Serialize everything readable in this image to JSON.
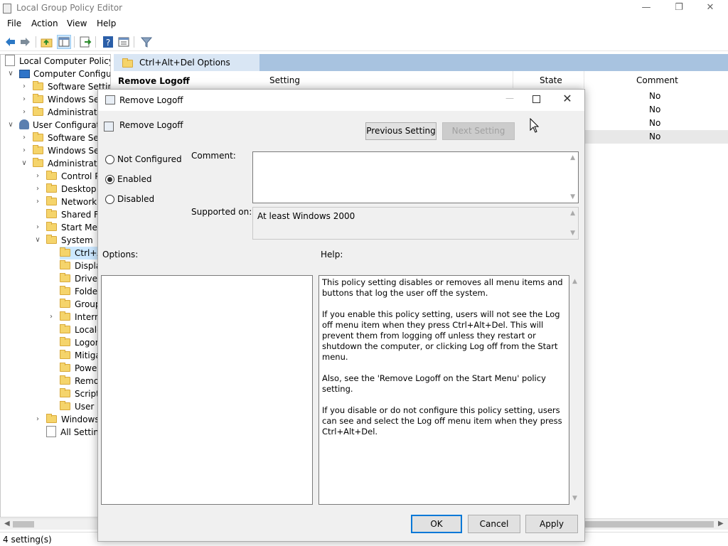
{
  "window": {
    "title": "Local Group Policy Editor"
  },
  "menu": [
    "File",
    "Action",
    "View",
    "Help"
  ],
  "tree": {
    "root": "Local Computer Policy",
    "items": [
      {
        "label": "Computer Configura",
        "indent": 1,
        "icon": "pc-icon",
        "expander": "expanded"
      },
      {
        "label": "Software Settings",
        "indent": 2,
        "icon": "folder-icon",
        "expander": "collapsed"
      },
      {
        "label": "Windows Setti",
        "indent": 2,
        "icon": "folder-icon",
        "expander": "collapsed"
      },
      {
        "label": "Administrative",
        "indent": 2,
        "icon": "folder-icon",
        "expander": "collapsed"
      },
      {
        "label": "User Configuratio",
        "indent": 1,
        "icon": "user-icon",
        "expander": "expanded"
      },
      {
        "label": "Software Setti",
        "indent": 2,
        "icon": "folder-icon",
        "expander": "collapsed"
      },
      {
        "label": "Windows Setti",
        "indent": 2,
        "icon": "folder-icon",
        "expander": "collapsed"
      },
      {
        "label": "Administrative",
        "indent": 2,
        "icon": "folder-icon",
        "expander": "expanded"
      },
      {
        "label": "Control Pa",
        "indent": 3,
        "icon": "folder-icon",
        "expander": "collapsed"
      },
      {
        "label": "Desktop",
        "indent": 3,
        "icon": "folder-icon",
        "expander": "collapsed"
      },
      {
        "label": "Network",
        "indent": 3,
        "icon": "folder-icon",
        "expander": "collapsed"
      },
      {
        "label": "Shared Fol",
        "indent": 3,
        "icon": "folder-icon",
        "expander": "none"
      },
      {
        "label": "Start Menu",
        "indent": 3,
        "icon": "folder-icon",
        "expander": "collapsed"
      },
      {
        "label": "System",
        "indent": 3,
        "icon": "folder-icon",
        "expander": "expanded"
      },
      {
        "label": "Ctrl+A",
        "indent": 4,
        "icon": "folder-icon",
        "expander": "none",
        "selected": true
      },
      {
        "label": "Display",
        "indent": 4,
        "icon": "folder-icon",
        "expander": "none"
      },
      {
        "label": "Driver I",
        "indent": 4,
        "icon": "folder-icon",
        "expander": "none"
      },
      {
        "label": "Folder",
        "indent": 4,
        "icon": "folder-icon",
        "expander": "none"
      },
      {
        "label": "Group",
        "indent": 4,
        "icon": "folder-icon",
        "expander": "none"
      },
      {
        "label": "Interne",
        "indent": 4,
        "icon": "folder-icon",
        "expander": "collapsed"
      },
      {
        "label": "Locale",
        "indent": 4,
        "icon": "folder-icon",
        "expander": "none"
      },
      {
        "label": "Logon",
        "indent": 4,
        "icon": "folder-icon",
        "expander": "none"
      },
      {
        "label": "Mitigat",
        "indent": 4,
        "icon": "folder-icon",
        "expander": "none"
      },
      {
        "label": "Power",
        "indent": 4,
        "icon": "folder-icon",
        "expander": "none"
      },
      {
        "label": "Remov",
        "indent": 4,
        "icon": "folder-icon",
        "expander": "none"
      },
      {
        "label": "Scripts",
        "indent": 4,
        "icon": "folder-icon",
        "expander": "none"
      },
      {
        "label": "User Pr",
        "indent": 4,
        "icon": "folder-icon",
        "expander": "none"
      },
      {
        "label": "Windows C",
        "indent": 3,
        "icon": "folder-icon",
        "expander": "collapsed"
      },
      {
        "label": "All Setting",
        "indent": 3,
        "icon": "doc-icon",
        "expander": "none"
      }
    ]
  },
  "right_pane": {
    "path": "Ctrl+Alt+Del Options",
    "selected_policy": "Remove Logoff",
    "columns": [
      "Setting",
      "State",
      "Comment"
    ],
    "comment_values": [
      "No",
      "No",
      "No",
      "No"
    ]
  },
  "dialog": {
    "title": "Remove Logoff",
    "heading": "Remove Logoff",
    "prev_label": "Previous Setting",
    "next_label": "Next Setting",
    "radios": {
      "not_configured": "Not Configured",
      "enabled": "Enabled",
      "disabled": "Disabled",
      "selected": "enabled"
    },
    "comment_label": "Comment:",
    "comment_value": "",
    "supported_label": "Supported on:",
    "supported_value": "At least Windows 2000",
    "options_label": "Options:",
    "help_label": "Help:",
    "help_paragraphs": [
      "This policy setting disables or removes all menu items and buttons that log the user off the system.",
      "If you enable this policy setting, users will not see the Log off menu item when they press Ctrl+Alt+Del. This will prevent them from logging off unless they restart or shutdown the computer, or clicking Log off from the Start menu.",
      "Also, see the 'Remove Logoff on the Start Menu' policy setting.",
      "If you disable or do not configure this policy setting, users can see and select the Log off menu item when they press Ctrl+Alt+Del."
    ],
    "ok_label": "OK",
    "cancel_label": "Cancel",
    "apply_label": "Apply"
  },
  "status": "4 setting(s)"
}
